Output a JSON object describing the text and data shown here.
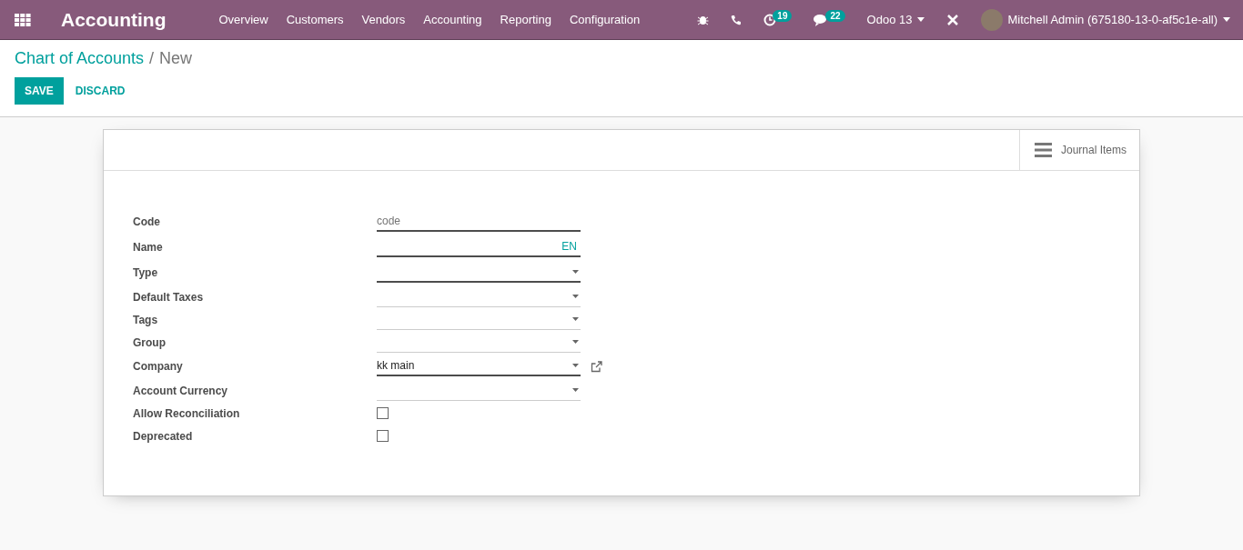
{
  "navbar": {
    "app_name": "Accounting",
    "menu": [
      "Overview",
      "Customers",
      "Vendors",
      "Accounting",
      "Reporting",
      "Configuration"
    ],
    "activity_count": "19",
    "message_count": "22",
    "database": "Odoo 13",
    "user": "Mitchell Admin (675180-13-0-af5c1e-all)"
  },
  "breadcrumb": {
    "parent": "Chart of Accounts",
    "separator": "/",
    "current": "New"
  },
  "buttons": {
    "save": "SAVE",
    "discard": "DISCARD"
  },
  "smart_button": {
    "label": "Journal Items"
  },
  "fields": [
    {
      "label": "Code",
      "kind": "text",
      "placeholder": "code",
      "required": true
    },
    {
      "label": "Name",
      "kind": "translate",
      "lang": "EN",
      "required": true
    },
    {
      "label": "Type",
      "kind": "select",
      "required": true
    },
    {
      "label": "Default Taxes",
      "kind": "select",
      "required": false
    },
    {
      "label": "Tags",
      "kind": "select",
      "required": false
    },
    {
      "label": "Group",
      "kind": "select",
      "required": false
    },
    {
      "label": "Company",
      "kind": "select",
      "value": "kk main",
      "required": true,
      "external_link": true
    },
    {
      "label": "Account Currency",
      "kind": "select",
      "required": false
    },
    {
      "label": "Allow Reconciliation",
      "kind": "checkbox",
      "checked": false
    },
    {
      "label": "Deprecated",
      "kind": "checkbox",
      "checked": false
    }
  ]
}
